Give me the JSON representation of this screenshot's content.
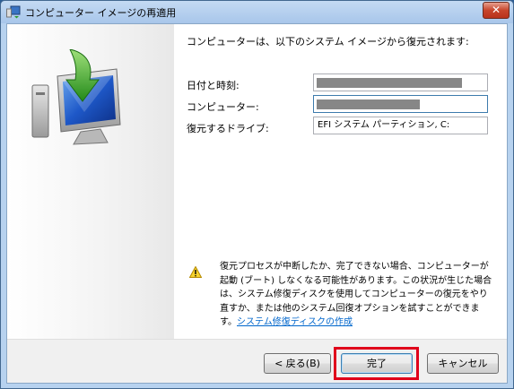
{
  "window": {
    "title": "コンピューター イメージの再適用",
    "close_label": "✕"
  },
  "main": {
    "heading": "コンピューターは、以下のシステム イメージから復元されます:",
    "fields": [
      {
        "label": "日付と時刻:",
        "value": ""
      },
      {
        "label": "コンピューター:",
        "value": ""
      },
      {
        "label": "復元するドライブ:",
        "value": "EFI システム パーティション, C:"
      }
    ]
  },
  "warning": {
    "icon": "warning-icon",
    "text": "復元プロセスが中断したか、完了できない場合、コンピューターが起動 (ブート) しなくなる可能性があります。この状況が生じた場合は、システム修復ディスクを使用してコンピューターの復元をやり直すか、または他のシステム回復オプションを試すことができます。",
    "link": "システム修復ディスクの作成"
  },
  "buttons": {
    "back": "< 戻る(B)",
    "finish": "完了",
    "cancel": "キャンセル"
  },
  "colors": {
    "highlight": "#e0001b",
    "link": "#0066cc"
  }
}
